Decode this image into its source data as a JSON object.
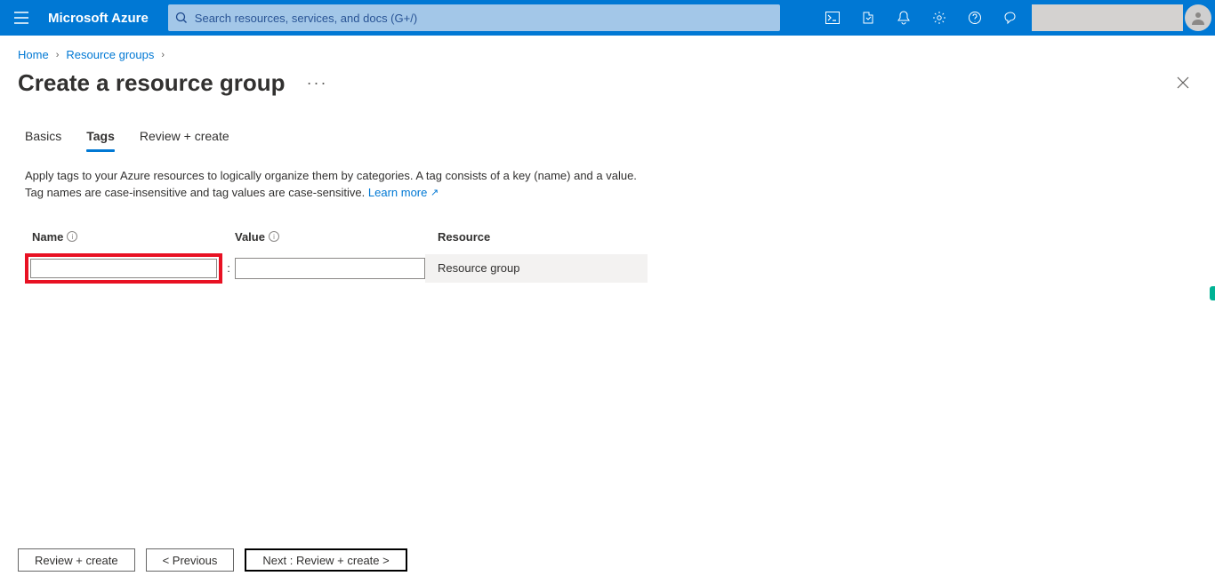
{
  "header": {
    "brand": "Microsoft Azure",
    "search_placeholder": "Search resources, services, and docs (G+/)"
  },
  "breadcrumb": {
    "items": [
      "Home",
      "Resource groups"
    ]
  },
  "page": {
    "title": "Create a resource group",
    "more_label": "···"
  },
  "tabs": [
    {
      "label": "Basics",
      "active": false
    },
    {
      "label": "Tags",
      "active": true
    },
    {
      "label": "Review + create",
      "active": false
    }
  ],
  "description": {
    "line1": "Apply tags to your Azure resources to logically organize them by categories. A tag consists of a key (name) and a value.",
    "line2_prefix": "Tag names are case-insensitive and tag values are case-sensitive. ",
    "learn_more": "Learn more"
  },
  "tag_columns": {
    "name": "Name",
    "value": "Value",
    "resource": "Resource"
  },
  "tag_row": {
    "name_value": "",
    "value_value": "",
    "resource_label": "Resource group",
    "separator": ":"
  },
  "footer": {
    "review_create": "Review + create",
    "previous": "<  Previous",
    "next": "Next : Review + create  >"
  }
}
